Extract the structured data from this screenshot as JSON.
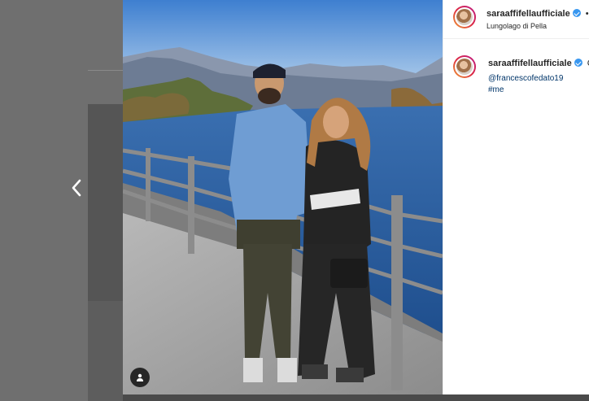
{
  "post": {
    "username": "saraaffifellaufficiale",
    "dot_separator": "•",
    "location": "Lungolago di Pella"
  },
  "caption": {
    "username": "saraaffifellaufficiale",
    "text_start": "C",
    "mention": "@francescofedato19",
    "hashtag": "#me"
  },
  "icons": {
    "prev": "chevron-left-icon",
    "tag": "user-tag-icon",
    "verified": "verified-badge-icon"
  },
  "colors": {
    "verified": "#3897f0",
    "link": "#003569",
    "text": "#262626"
  }
}
